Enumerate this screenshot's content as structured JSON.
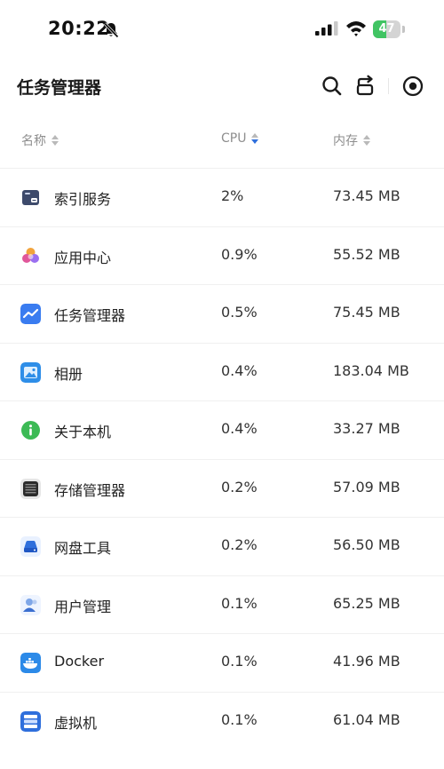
{
  "status_bar": {
    "time": "20:22",
    "battery_percent": "47",
    "battery_level": 0.47,
    "battery_color": "#41c463"
  },
  "header": {
    "title": "任务管理器",
    "icons": [
      "search-icon",
      "refresh-icon",
      "target-icon"
    ]
  },
  "columns": {
    "name": "名称",
    "cpu": "CPU",
    "memory": "内存",
    "active_sort": "cpu-descending",
    "sort_active_color": "#2f6fdc"
  },
  "processes": [
    {
      "name": "索引服务",
      "cpu": "2%",
      "memory": "73.45 MB",
      "icon": "index-service-icon"
    },
    {
      "name": "应用中心",
      "cpu": "0.9%",
      "memory": "55.52 MB",
      "icon": "app-center-icon"
    },
    {
      "name": "任务管理器",
      "cpu": "0.5%",
      "memory": "75.45 MB",
      "icon": "task-manager-icon"
    },
    {
      "name": "相册",
      "cpu": "0.4%",
      "memory": "183.04 MB",
      "icon": "photos-icon"
    },
    {
      "name": "关于本机",
      "cpu": "0.4%",
      "memory": "33.27 MB",
      "icon": "about-icon"
    },
    {
      "name": "存储管理器",
      "cpu": "0.2%",
      "memory": "57.09 MB",
      "icon": "storage-manager-icon"
    },
    {
      "name": "网盘工具",
      "cpu": "0.2%",
      "memory": "56.50 MB",
      "icon": "cloud-drive-icon"
    },
    {
      "name": "用户管理",
      "cpu": "0.1%",
      "memory": "65.25 MB",
      "icon": "user-management-icon"
    },
    {
      "name": "Docker",
      "cpu": "0.1%",
      "memory": "41.96 MB",
      "icon": "docker-icon"
    },
    {
      "name": "虚拟机",
      "cpu": "0.1%",
      "memory": "61.04 MB",
      "icon": "virtual-machine-icon"
    }
  ]
}
